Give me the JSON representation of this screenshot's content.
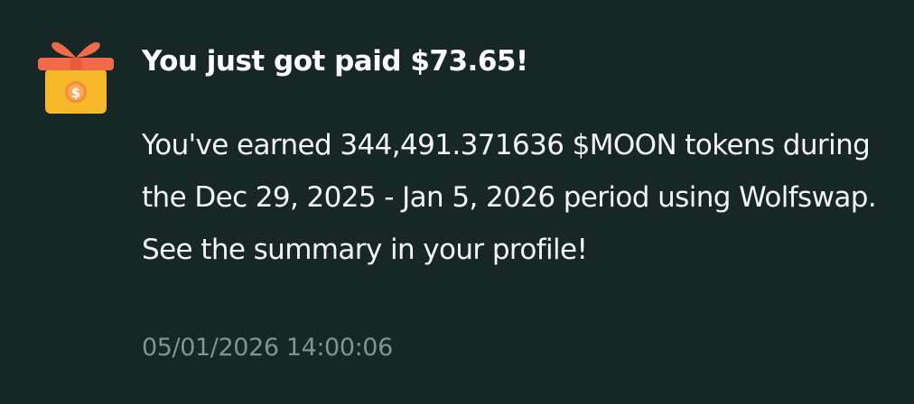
{
  "notification": {
    "icon": "gift-box-coin-icon",
    "title": "You just got paid $73.65!",
    "message": "You've earned 344,491.371636 $MOON tokens during the Dec 29, 2025 - Jan 5, 2026 period using Wolfswap. See the summary in your profile!",
    "timestamp": "05/01/2026 14:00:06",
    "coin_symbol": "$"
  },
  "colors": {
    "background": "#162726",
    "title": "#ffffff",
    "body_text": "#f4f6f5",
    "timestamp": "#7f9590",
    "gift_box": "#f7b928",
    "gift_lid_and_ribbon": "#f26a4a",
    "coin": "#f58a3c"
  }
}
